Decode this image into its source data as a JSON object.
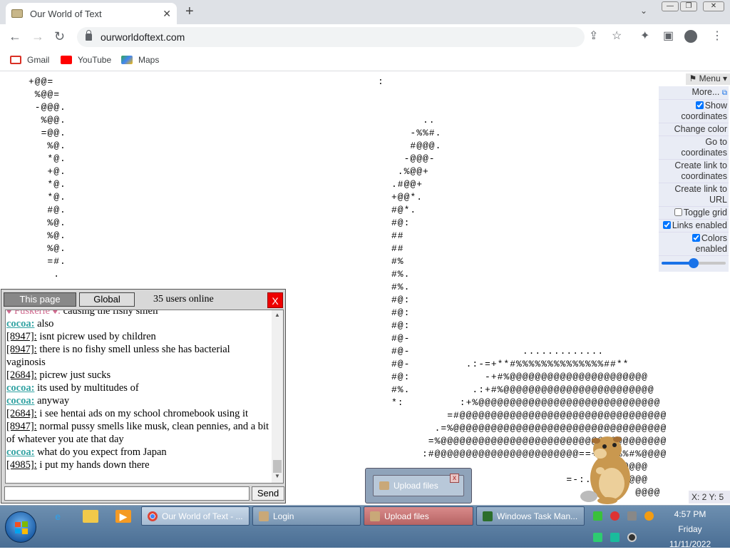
{
  "browser": {
    "tab_title": "Our World of Text",
    "url": "ourworldoftext.com",
    "bookmarks": [
      {
        "label": "Gmail",
        "icon": "gmail-icon"
      },
      {
        "label": "YouTube",
        "icon": "youtube-icon"
      },
      {
        "label": "Maps",
        "icon": "maps-icon"
      }
    ]
  },
  "world": {
    "ascii_left": "+@@=\n %@@=\n -@@@.\n  %@@.\n  =@@.\n   %@.\n   *@.\n   +@.\n   *@.\n   *@.\n   #@.\n   %@.\n   %@.\n   %@.\n   =#.\n    .",
    "ascii_colon": ":",
    "ascii_middle": "     ..\n   -%%#.\n   #@@@.\n  -@@@-\n .%@@+\n.#@@+\n+@@*.\n#@*.\n#@:\n##\n##\n#%\n#%.\n#%.\n#@:\n#@:\n#@:\n#@-\n#@-\n#@-\n#@:\n#%.\n*:",
    "ascii_right": "                .............\n       .:-=+**#%%%%%%%%%%%%%%##**\n          -+#%@@@@@@@@@@@@@@@@@@@@@@\n        .:+#%@@@@@@@@@@@@@@@@@@@@@@@@\n      :+%@@@@@@@@@@@@@@@@@@@@@@@@@@@@@\n    =#@@@@@@@@@@@@@@@@@@@@@@@@@@@@@@@@@\n  .=%@@@@@@@@@@@@@@@@@@@@@@@@@@@@@@@@@@\n =%@@@@@@@@@@@@@@@@@@@@@@@@@@@@@@@@@@@@\n:#@@@@@@@@@@@@@@@@@@@@@@@==++*#%%#%@@@@\n                               +@@@@\n                       =-:...:*@@@@@\n                                  @@@@"
  },
  "menu": {
    "title": "Menu",
    "items": [
      {
        "label": "More...",
        "type": "link"
      },
      {
        "label": "Show coordinates",
        "type": "checkbox",
        "checked": true
      },
      {
        "label": "Change color",
        "type": "link"
      },
      {
        "label": "Go to coordinates",
        "type": "link"
      },
      {
        "label": "Create link to coordinates",
        "type": "link"
      },
      {
        "label": "Create link to URL",
        "type": "link"
      },
      {
        "label": "Toggle grid",
        "type": "checkbox",
        "checked": false
      },
      {
        "label": "Links enabled",
        "type": "checkbox",
        "checked": true
      },
      {
        "label": "Colors enabled",
        "type": "checkbox",
        "checked": true
      }
    ],
    "zoom_fraction": 0.5
  },
  "chat": {
    "tab_page": "This page",
    "tab_global": "Global",
    "online": "35 users online",
    "close": "X",
    "send": "Send",
    "input_value": "",
    "messages": [
      {
        "nick": "♦ Fuskerle ♦:",
        "kind": "pink",
        "text": " causing the fishy smell"
      },
      {
        "nick": "cocoa:",
        "kind": "reg",
        "text": " also"
      },
      {
        "nick": "[8947]:",
        "kind": "id",
        "text": " isnt picrew used by children"
      },
      {
        "nick": "[8947]:",
        "kind": "id",
        "text": " there is no fishy smell unless she has bacterial vaginosis"
      },
      {
        "nick": "[2684]:",
        "kind": "id",
        "text": " picrew just sucks"
      },
      {
        "nick": "cocoa:",
        "kind": "reg",
        "text": " its used by multitudes of"
      },
      {
        "nick": "cocoa:",
        "kind": "reg",
        "text": " anyway"
      },
      {
        "nick": "[2684]:",
        "kind": "id",
        "text": " i see hentai ads on my school chromebook using it"
      },
      {
        "nick": "[8947]:",
        "kind": "id",
        "text": " normal pussy smells like musk, clean pennies, and a bit of whatever you ate that day"
      },
      {
        "nick": "cocoa:",
        "kind": "reg",
        "text": " what do you expect from Japan"
      },
      {
        "nick": "[4985]:",
        "kind": "id",
        "text": " i put my hands down there"
      }
    ]
  },
  "upload_popup": {
    "label": "Upload files"
  },
  "coords": "X: 2 Y: 5",
  "taskbar": {
    "tasks": [
      {
        "label": "Our World of Text - ...",
        "icon": "chrome-icon",
        "state": "active"
      },
      {
        "label": "Login",
        "icon": "app-icon",
        "state": "normal"
      },
      {
        "label": "Upload files",
        "icon": "upload-icon",
        "state": "highlight"
      },
      {
        "label": "Windows Task Man...",
        "icon": "task-manager-icon",
        "state": "normal"
      }
    ],
    "time": "4:57 PM",
    "day": "Friday",
    "date": "11/11/2022"
  }
}
